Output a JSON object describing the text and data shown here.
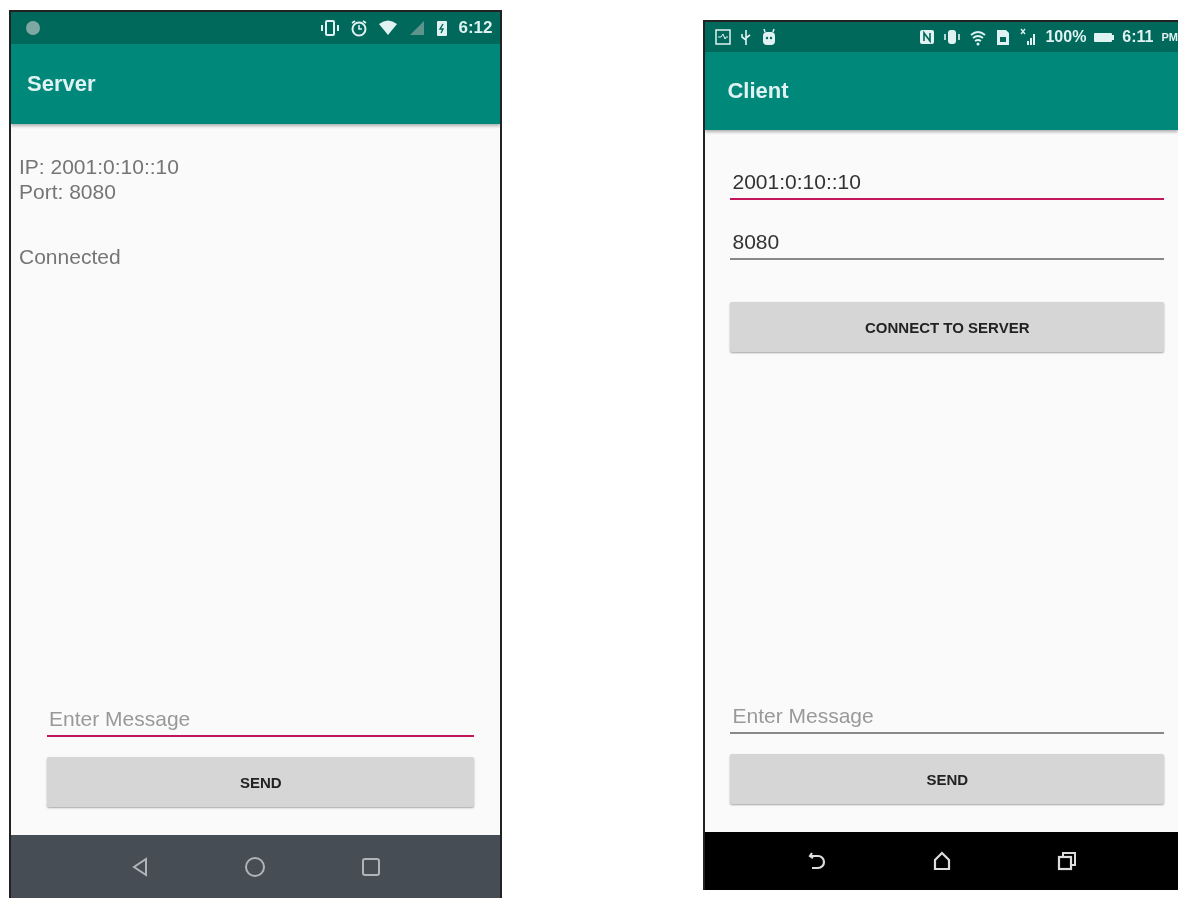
{
  "server": {
    "status_bar": {
      "time": "6:12"
    },
    "app_bar": {
      "title": "Server"
    },
    "info": [
      "IP: 2001:0:10::10",
      "Port: 8080"
    ],
    "status": "Connected",
    "message_field": {
      "placeholder": "Enter Message",
      "focused": true
    },
    "send_button": "SEND"
  },
  "client": {
    "status_bar": {
      "battery": "100%",
      "time": "6:11",
      "period": "PM"
    },
    "app_bar": {
      "title": "Client"
    },
    "fields": [
      {
        "value": "2001:0:10::10",
        "focused": true
      },
      {
        "value": "8080",
        "focused": false
      }
    ],
    "connect_button": "CONNECT TO SERVER",
    "message_field": {
      "placeholder": "Enter Message",
      "focused": false
    },
    "send_button": "SEND"
  }
}
